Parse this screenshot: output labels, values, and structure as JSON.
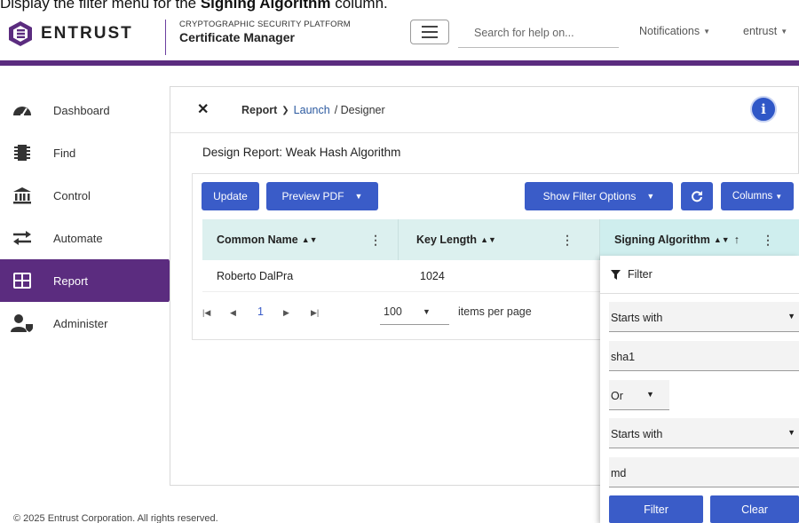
{
  "caption": {
    "prefix": "Display the filter menu for the ",
    "bold": "Signing Algorithm",
    "suffix": " column."
  },
  "header": {
    "brand": "ENTRUST",
    "product_sub": "CRYPTOGRAPHIC SECURITY PLATFORM",
    "product_title": "Certificate Manager",
    "search_placeholder": "Search for help on...",
    "notifications": "Notifications",
    "user": "entrust"
  },
  "sidebar": {
    "items": [
      {
        "label": "Dashboard",
        "icon": "speedometer-icon"
      },
      {
        "label": "Find",
        "icon": "chip-icon"
      },
      {
        "label": "Control",
        "icon": "bank-icon"
      },
      {
        "label": "Automate",
        "icon": "swap-arrows-icon"
      },
      {
        "label": "Report",
        "icon": "table-icon",
        "active": true
      },
      {
        "label": "Administer",
        "icon": "user-shield-icon"
      }
    ]
  },
  "breadcrumb": {
    "report": "Report",
    "launch": "Launch",
    "designer": "/ Designer"
  },
  "design_title": "Design Report: Weak Hash Algorithm",
  "toolbar": {
    "update": "Update",
    "preview_pdf": "Preview PDF",
    "show_filter": "Show Filter Options",
    "columns": "Columns"
  },
  "table": {
    "columns": [
      "Common Name",
      "Key Length",
      "Signing Algorithm"
    ],
    "rows": [
      [
        "Roberto DalPra",
        "1024",
        ""
      ]
    ]
  },
  "pager": {
    "page": "1",
    "page_size": "100",
    "items_label": "items per page"
  },
  "filter_menu": {
    "title": "Filter",
    "op1": "Starts with",
    "val1": "sha1",
    "logic": "Or",
    "op2": "Starts with",
    "val2": "md",
    "filter_btn": "Filter",
    "clear_btn": "Clear"
  },
  "footer": "© 2025 Entrust Corporation. All rights reserved.",
  "colors": {
    "purple": "#5b2c7f",
    "button_blue": "#3a5cc8",
    "header_teal": "#dcf0ef"
  }
}
